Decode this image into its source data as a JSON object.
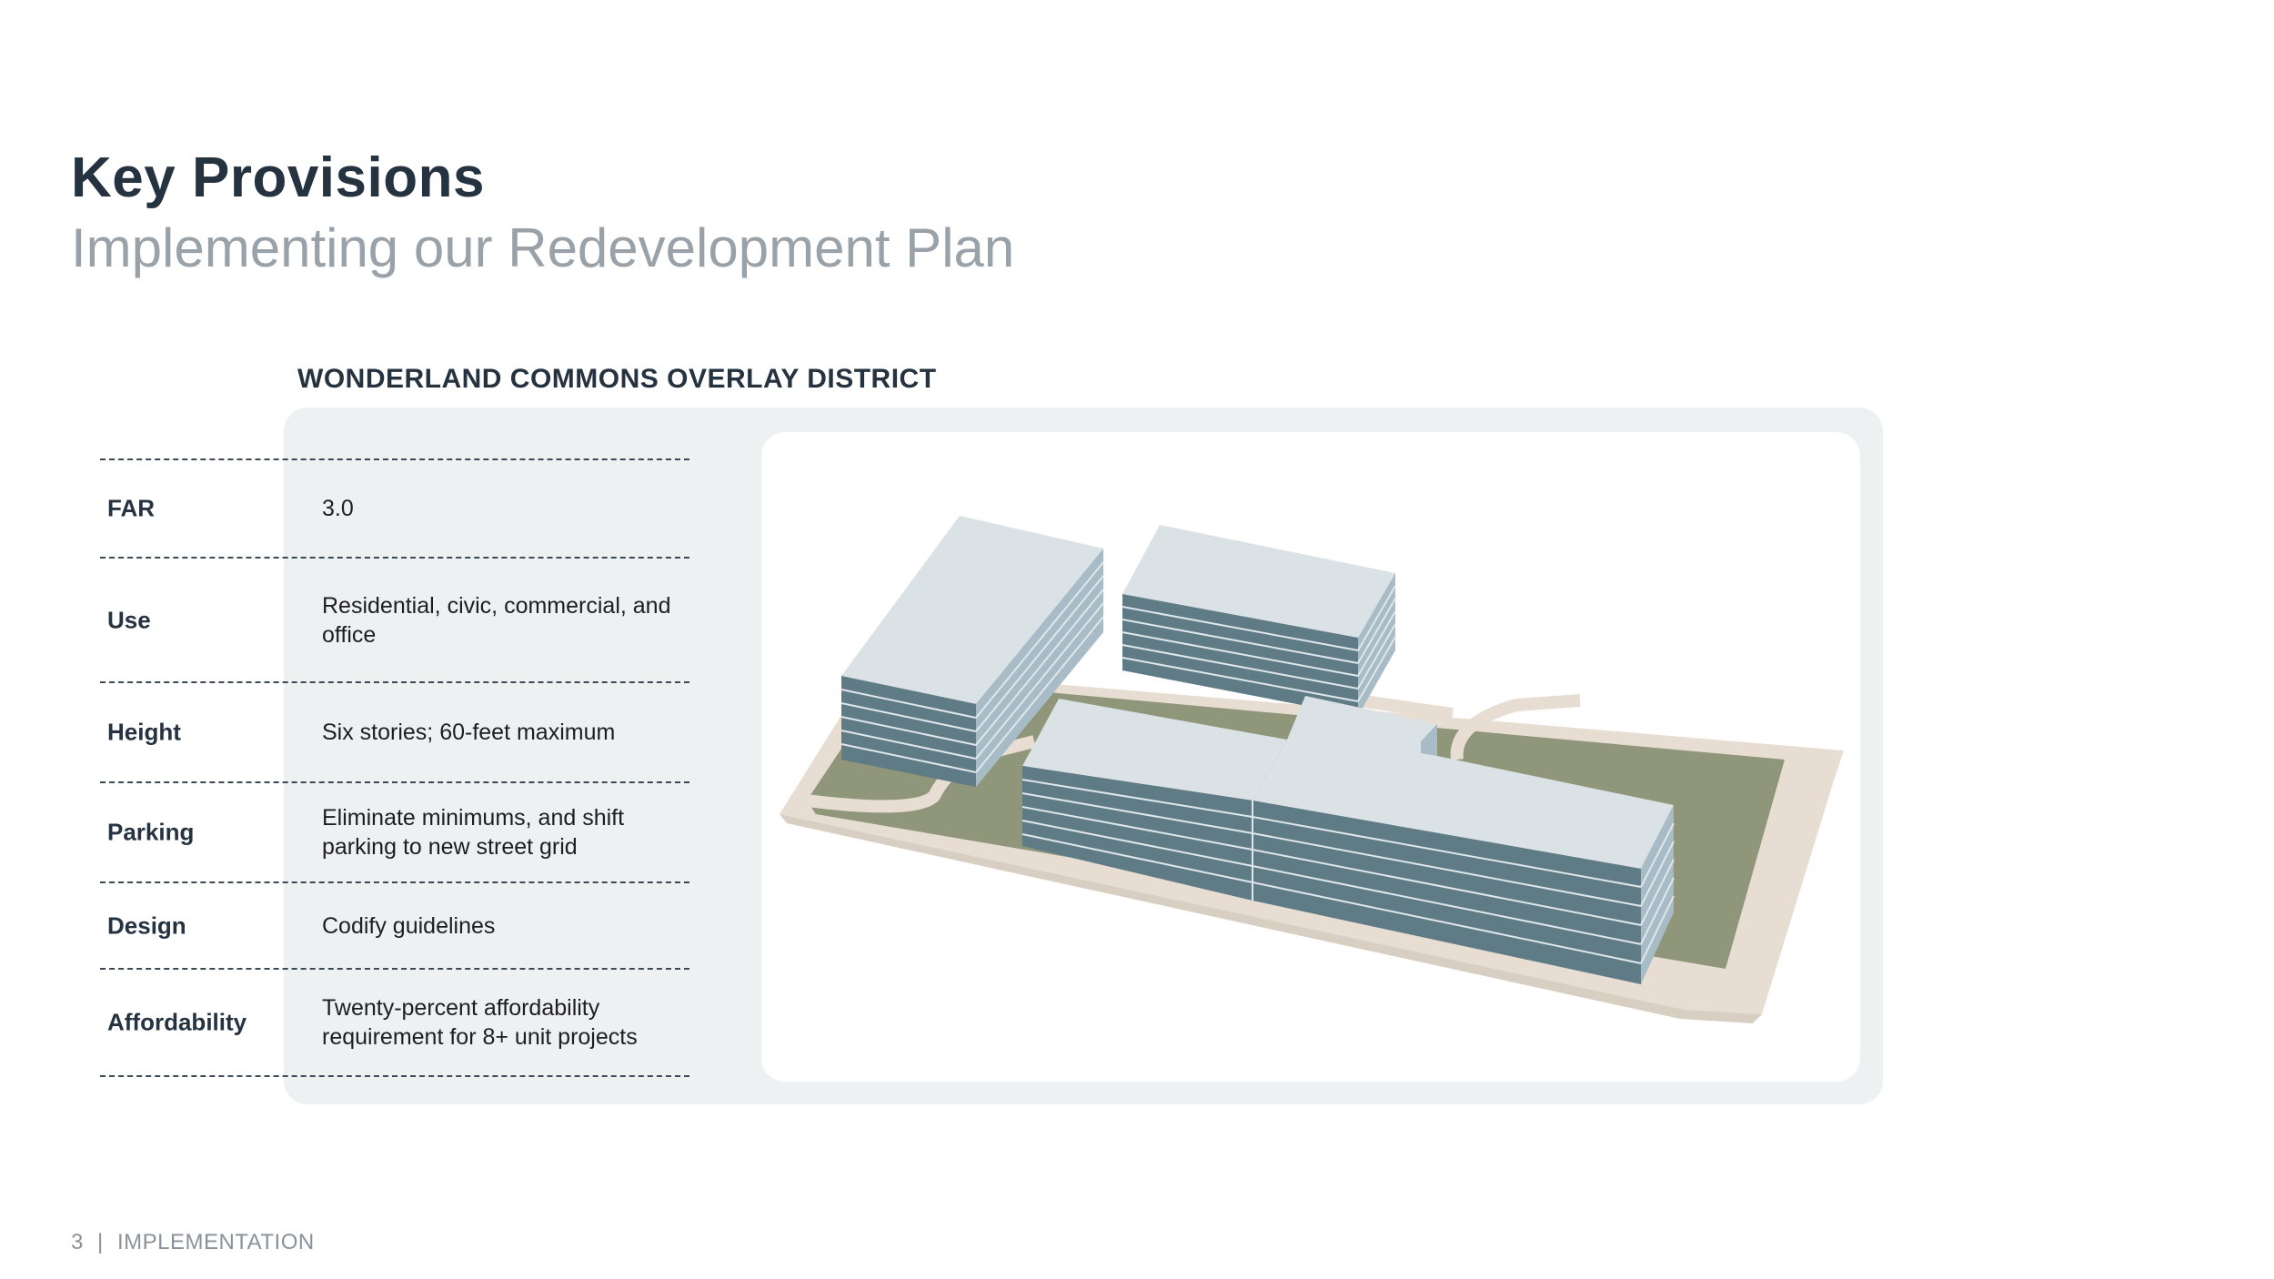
{
  "header": {
    "title": "Key Provisions",
    "subtitle": "Implementing our Redevelopment Plan"
  },
  "district": {
    "title": "WONDERLAND COMMONS OVERLAY DISTRICT",
    "provisions": [
      {
        "label": "FAR",
        "value": "3.0"
      },
      {
        "label": "Use",
        "value": "Residential, civic, commercial, and office"
      },
      {
        "label": "Height",
        "value": "Six stories; 60-feet maximum"
      },
      {
        "label": "Parking",
        "value": "Eliminate minimums, and shift parking to new street grid"
      },
      {
        "label": "Design",
        "value": "Codify guidelines"
      },
      {
        "label": "Affordability",
        "value": "Twenty-percent affordability requirement for 8+ unit projects"
      }
    ]
  },
  "footer": {
    "page_number": "3",
    "separator": "|",
    "section": "IMPLEMENTATION"
  },
  "colors": {
    "heading": "#253341",
    "subtitle": "#9aa2a9",
    "panel": "#eef1f2",
    "grass": "#8f9679",
    "site_base": "#e7ddd2",
    "roof": "#dae2e5",
    "facade": "#5f7b86",
    "side": "#a7bcc6"
  }
}
